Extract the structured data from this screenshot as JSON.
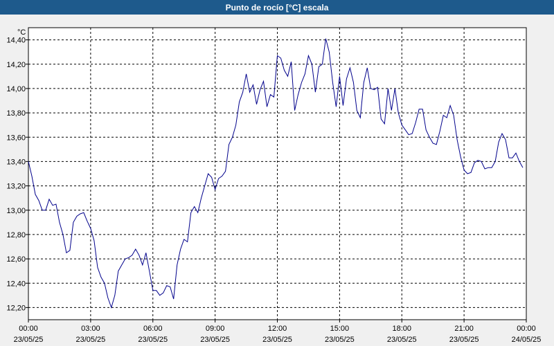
{
  "chart_data": {
    "type": "line",
    "title": "Punto de rocío [°C] escala",
    "ylabel": "°C",
    "xlabel": "",
    "ylim": [
      12.1,
      14.5
    ],
    "xlim": [
      0,
      24
    ],
    "grid": true,
    "legend": "none",
    "colors": {
      "line": "#00008b",
      "title_bg": "#1e5a8c",
      "plot_bg": "#ffffff",
      "grid": "#000000"
    },
    "y_ticks": [
      {
        "value": 12.2,
        "label": "12,20"
      },
      {
        "value": 12.4,
        "label": "12,40"
      },
      {
        "value": 12.6,
        "label": "12,60"
      },
      {
        "value": 12.8,
        "label": "12,80"
      },
      {
        "value": 13.0,
        "label": "13,00"
      },
      {
        "value": 13.2,
        "label": "13,20"
      },
      {
        "value": 13.4,
        "label": "13,40"
      },
      {
        "value": 13.6,
        "label": "13,60"
      },
      {
        "value": 13.8,
        "label": "13,80"
      },
      {
        "value": 14.0,
        "label": "14,00"
      },
      {
        "value": 14.2,
        "label": "14,20"
      },
      {
        "value": 14.4,
        "label": "14,40"
      }
    ],
    "x_ticks": [
      {
        "value": 0,
        "time": "00:00",
        "date": "23/05/25"
      },
      {
        "value": 3,
        "time": "03:00",
        "date": "23/05/25"
      },
      {
        "value": 6,
        "time": "06:00",
        "date": "23/05/25"
      },
      {
        "value": 9,
        "time": "09:00",
        "date": "23/05/25"
      },
      {
        "value": 12,
        "time": "12:00",
        "date": "23/05/25"
      },
      {
        "value": 15,
        "time": "15:00",
        "date": "23/05/25"
      },
      {
        "value": 18,
        "time": "18:00",
        "date": "23/05/25"
      },
      {
        "value": 21,
        "time": "21:00",
        "date": "23/05/25"
      },
      {
        "value": 24,
        "time": "00:00",
        "date": "24/05/25"
      }
    ],
    "series": [
      {
        "x": [
          0.0,
          0.167,
          0.333,
          0.5,
          0.667,
          0.833,
          1.0,
          1.167,
          1.333,
          1.5,
          1.667,
          1.833,
          2.0,
          2.167,
          2.333,
          2.5,
          2.667,
          2.833,
          3.0,
          3.167,
          3.333,
          3.5,
          3.667,
          3.833,
          4.0,
          4.167,
          4.333,
          4.5,
          4.667,
          4.833,
          5.0,
          5.167,
          5.333,
          5.5,
          5.667,
          5.833,
          6.0,
          6.167,
          6.333,
          6.5,
          6.667,
          6.833,
          7.0,
          7.167,
          7.333,
          7.5,
          7.667,
          7.833,
          8.0,
          8.167,
          8.333,
          8.5,
          8.667,
          8.833,
          9.0,
          9.167,
          9.333,
          9.5,
          9.667,
          9.833,
          10.0,
          10.167,
          10.333,
          10.5,
          10.667,
          10.833,
          11.0,
          11.167,
          11.333,
          11.5,
          11.667,
          11.833,
          12.0,
          12.167,
          12.333,
          12.5,
          12.667,
          12.833,
          13.0,
          13.167,
          13.333,
          13.5,
          13.667,
          13.833,
          14.0,
          14.167,
          14.333,
          14.5,
          14.667,
          14.833,
          15.0,
          15.167,
          15.333,
          15.5,
          15.667,
          15.833,
          16.0,
          16.167,
          16.333,
          16.5,
          16.667,
          16.833,
          17.0,
          17.167,
          17.333,
          17.5,
          17.667,
          17.833,
          18.0,
          18.167,
          18.333,
          18.5,
          18.667,
          18.833,
          19.0,
          19.167,
          19.333,
          19.5,
          19.667,
          19.833,
          20.0,
          20.167,
          20.333,
          20.5,
          20.667,
          20.833,
          21.0,
          21.167,
          21.333,
          21.5,
          21.667,
          21.833,
          22.0,
          22.167,
          22.333,
          22.5,
          22.667,
          22.833,
          23.0,
          23.167,
          23.333,
          23.5,
          23.667,
          23.833
        ],
        "values": [
          13.4,
          13.28,
          13.13,
          13.08,
          13.0,
          13.0,
          13.09,
          13.04,
          13.05,
          12.9,
          12.8,
          12.65,
          12.67,
          12.9,
          12.95,
          12.97,
          12.98,
          12.91,
          12.85,
          12.75,
          12.53,
          12.45,
          12.4,
          12.28,
          12.2,
          12.3,
          12.5,
          12.55,
          12.6,
          12.61,
          12.63,
          12.68,
          12.63,
          12.55,
          12.65,
          12.5,
          12.34,
          12.34,
          12.3,
          12.32,
          12.38,
          12.37,
          12.27,
          12.55,
          12.68,
          12.76,
          12.74,
          12.98,
          13.03,
          12.98,
          13.1,
          13.2,
          13.3,
          13.27,
          13.17,
          13.26,
          13.28,
          13.32,
          13.54,
          13.6,
          13.7,
          13.89,
          13.97,
          14.12,
          13.97,
          14.03,
          13.87,
          13.99,
          14.06,
          13.85,
          13.95,
          13.93,
          14.27,
          14.25,
          14.15,
          14.1,
          14.22,
          13.82,
          13.95,
          14.05,
          14.12,
          14.27,
          14.2,
          13.97,
          14.18,
          14.2,
          14.41,
          14.3,
          14.05,
          13.85,
          14.1,
          13.86,
          14.08,
          14.17,
          14.05,
          13.82,
          13.76,
          14.05,
          14.17,
          14.0,
          13.99,
          14.01,
          13.75,
          13.71,
          14.0,
          13.82,
          14.0,
          13.8,
          13.7,
          13.66,
          13.62,
          13.63,
          13.72,
          13.83,
          13.83,
          13.66,
          13.6,
          13.55,
          13.54,
          13.65,
          13.78,
          13.76,
          13.86,
          13.78,
          13.58,
          13.44,
          13.33,
          13.3,
          13.31,
          13.39,
          13.41,
          13.4,
          13.34,
          13.35,
          13.35,
          13.4,
          13.56,
          13.63,
          13.58,
          13.43,
          13.43,
          13.47,
          13.4,
          13.35
        ]
      }
    ]
  }
}
